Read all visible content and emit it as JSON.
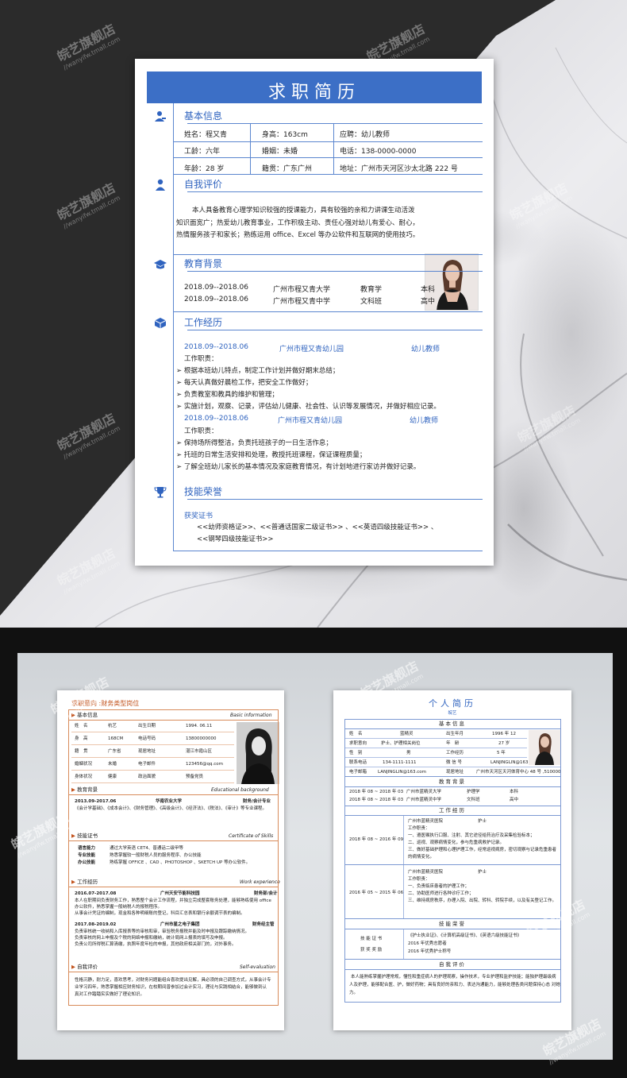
{
  "watermark": {
    "brand": "皖艺旗舰店",
    "url": "//wanyifw.tmall.com"
  },
  "resume_main": {
    "title": "求职简历",
    "sections": {
      "basic": "基本信息",
      "self": "自我评价",
      "edu": "教育背景",
      "work": "工作经历",
      "skills": "技能荣誉"
    },
    "basic_info": [
      [
        "姓名：程又青",
        "身高：163cm",
        "应聘：幼儿教师"
      ],
      [
        "工龄：六年",
        "婚姻：未婚",
        "电话：138-0000-0000"
      ],
      [
        "年龄：28 岁",
        "籍贯：广东广州",
        "地址：广州市天河区沙太北路 222 号"
      ]
    ],
    "self_eval": "本人具备教育心理学知识较强的授课能力，具有较强的亲和力讲课生动活泼知识面宽广；热爱幼儿教育事业，工作积极主动、责任心强对幼儿有爱心、耐心，热情服务孩子和家长；熟练运用 office、Excel 等办公软件和互联网的使用技巧。",
    "education": [
      [
        "2018.09--2018.06",
        "广州市程又青大学",
        "教育学",
        "本科"
      ],
      [
        "2018.09--2018.06",
        "广州市程又青中学",
        "文科班",
        "高中"
      ]
    ],
    "work": [
      {
        "period": "2018.09--2018.06",
        "company": "广州市程又青幼儿园",
        "role": "幼儿教师",
        "duty_label": "工作职责：",
        "duties": [
          "根据本班幼儿特点，制定工作计划并做好期末总结；",
          "每天认真做好晨检工作，把安全工作做好；",
          "负责教室和教具的维护和管理；",
          "实施计划，观察、记录，评估幼儿健康、社会性、认识等发展情况，并做好相应记录。"
        ]
      },
      {
        "period": "2018.09--2018.06",
        "company": "广州市程又青幼儿园",
        "role": "幼儿教师",
        "duty_label": "工作职责：",
        "duties": [
          "保持场所得整洁，负责托班孩子的一日生活作息；",
          "托班的日常生活安排和处理，教授托班课程，保证课程质量；",
          "了解全班幼儿家长的基本情况及家庭教育情况，有计划地进行家访并做好记录。"
        ]
      }
    ],
    "skills_label": "获奖证书",
    "skills_line1": "<<幼师资格证>>、<<普通话国家二级证书>> 、<<英语四级技能证书>> 、",
    "skills_line2": "<<钢琴四级技能证书>>"
  },
  "resume_left": {
    "intent": "求职意向 :财务类型岗位",
    "basic_title": "基本信息",
    "basic_en": "Basic information",
    "basic_rows": [
      [
        "姓　名",
        "杭艺",
        "出生日期",
        "1994. 06.11"
      ],
      [
        "身　高",
        "168CM",
        "电话号码",
        "13800000000"
      ],
      [
        "籍　贯",
        "广东省",
        "现居地址",
        "湛江市霞山区"
      ],
      [
        "婚姻状况",
        "未婚",
        "电子邮件",
        "123456@qq.com"
      ],
      [
        "身体状况",
        "健康",
        "政治面貌",
        "预备党员"
      ]
    ],
    "edu_title": "教育背景",
    "edu_en": "Educational background",
    "edu_line": [
      "2013.09-2017.06",
      "华南农业大学",
      "财务/会计专业"
    ],
    "edu_courses": "《会计学基础》、《成本会计》、《财务管理》、《高级会计》、《经济法》、《税法》、《审计》等专业课程。",
    "skill_title": "技能证书",
    "skill_en": "Certificate of Skills",
    "skills": [
      [
        "语言能力",
        "通过大学英语 CET4、普通话二级甲等"
      ],
      [
        "专业技能",
        "熟悉掌握较一般财税人员的服务程序、办公技能"
      ],
      [
        "办公技能",
        "熟练掌握 OFFICE 、CAD 、PHOTOSHOP 、SKETCH UP 等办公软件。"
      ]
    ],
    "work_title": "工作经历",
    "work_en": "Work experience",
    "jobs": [
      {
        "head": [
          "2016.07-2017.08",
          "广州天安节能科技园",
          "财务部/会计"
        ],
        "lines": [
          "本人在职期间负责财务工作，熟悉整个会计工作流程，并独立完成整套账务处理，能够熟练使用 office",
          "办公软件，熟悉掌握一般纳税人的报税程序。",
          "从事会计凭证的编制，现金和各种明细账的登记，科目汇总表和银行余额调节表的编制。"
        ]
      },
      {
        "head": [
          "2017.08-2019.02",
          "广州市星之电子集团",
          "财务经主管"
        ],
        "lines": [
          "负责审核统一收纳和入库报表等的审核和审，审验税务报税并能及时申报及跟踪缴纳情况。",
          "负责审核的网上申报及个税的网络申报和缴纳，统计局网上报表的填写及申报。",
          "负责公司所得税汇算清缴，执照年度年检的申报，其他政府相关部门的，对外事务。"
        ]
      }
    ],
    "self_title": "自我评价",
    "self_en": "Self-evaluation",
    "self_lines": [
      "性格沉静，耐力足，喜欢思考，对财务问题能组合喜欢提出见解，具必须的自己调查方式，从事会计专",
      "业学习四年，熟悉掌握相应财务知识，在校期间曾参加过会计实习，理论与实践相结合，能够做到认",
      "真对工作踏踏实实做好了理论知识。"
    ]
  },
  "resume_right": {
    "title": "个人简历",
    "name": "皖艺",
    "basic_title": "基本信息",
    "basic_rows": [
      [
        "姓　名",
        "蓝精灵",
        "出生年月",
        "1996 年 12"
      ],
      [
        "求职意向",
        "护士、护理相关岗位",
        "年　龄",
        "27 岁"
      ],
      [
        "性　别",
        "男",
        "工作经历",
        "5 年"
      ],
      [
        "联系电话",
        "134-1111-1111",
        "微 信 号",
        "LANJINGLIN@163.com"
      ],
      [
        "电子邮箱",
        "LANJINGLIN@163.com",
        "现居地址",
        "广州市天河区天河体育中心 48 号 ,510000"
      ]
    ],
    "edu_title": "教育背景",
    "edu_rows": [
      [
        "2018 年 08 ~ 2018 年 03",
        "广州市蓝精灵大学",
        "护理学",
        "本科"
      ],
      [
        "2018 年 08 ~ 2018 年 03",
        "广州市蓝精灵中学",
        "文科班",
        "高中"
      ]
    ],
    "work_title": "工作经历",
    "jobs": [
      {
        "period": "2018 年 08 ~ 2016 年 09",
        "company": "广州市蓝精灵医院",
        "role": "护士",
        "lines": [
          "工作职责：",
          "一、遵医嘱执行口服、注射、其它途径给药治疗及采集检验标本；",
          "二、巡视、观察病情变化，参与危重病救护记录。",
          "三、做好基础护理和心理护理工作，经常巡视病房，密切观察与记录危重患者",
          "的病情变化。"
        ]
      },
      {
        "period": "2016 年 05 ~ 2015 年 06",
        "company": "广州市蓝精灵医院",
        "role": "护士",
        "lines": [
          "工作职责：",
          "一、负责临床患者的护理工作；",
          "二、协助医师进行各种诊疗工作；",
          "三、维持病房秩序，办理入院、出院、转科、转院手续，以及有关登记工作。"
        ]
      }
    ],
    "honor_title": "技能荣誉",
    "honor_labels": [
      "技 能 证 书",
      "获 奖 奖 励"
    ],
    "honor_lines": [
      "《护士执业证》、《计算机高级证书》、《英语六级技能证书》",
      "2016 年优秀志愿者",
      "2016 年优秀护士称号"
    ],
    "self_title": "自我评价",
    "self_lines": [
      "本人能熟练掌握护理常规，懂性和重症病人的护理观察，操作技术，专业护理和监护技能；能独护理最级病",
      "人及护理，能够配合医、护，做好药物；具有良好的亲和力、表达沟通能力，能够处理各类问题保持心态 对她",
      "力。"
    ]
  },
  "colors": {
    "accent_blue": "#3c6fc6",
    "accent_orange": "#c2531d"
  }
}
